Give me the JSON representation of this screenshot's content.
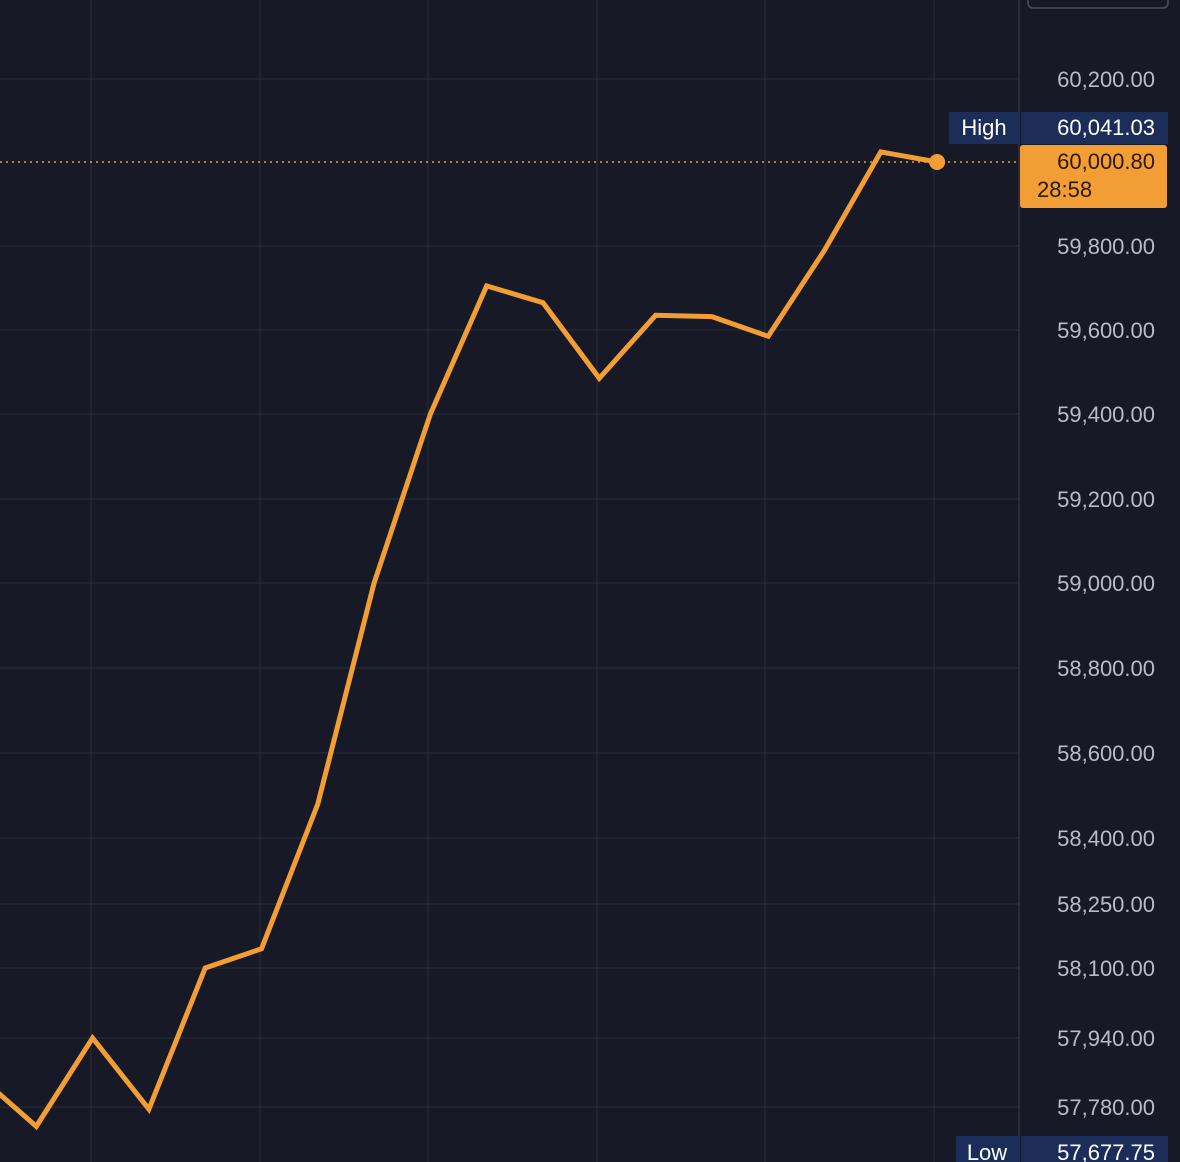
{
  "colors": {
    "background": "#171a26",
    "grid": "#2a2e3b",
    "axis_divider": "#3a3f4d",
    "line": "#f39e35",
    "tick_text": "#b9bcc6",
    "badge_navy": "#1c2d5a",
    "badge_text": "#ffffff",
    "current_badge_text": "#2a1a00"
  },
  "chart_data": {
    "type": "line",
    "title": "",
    "xlabel": "",
    "ylabel": "",
    "y_ticks": [
      "60,200.00",
      "59,800.00",
      "59,600.00",
      "59,400.00",
      "59,200.00",
      "59,000.00",
      "58,800.00",
      "58,600.00",
      "58,400.00",
      "58,250.00",
      "58,100.00",
      "57,940.00",
      "57,780.00"
    ],
    "y_tick_values": [
      60200,
      59800,
      59600,
      59400,
      59200,
      59000,
      58800,
      58600,
      58400,
      58250,
      58100,
      57940,
      57780
    ],
    "y_scale": "nonlinear",
    "grid": true,
    "series": [
      {
        "values": [
          57850,
          57735,
          57940,
          57775,
          58100,
          58145,
          58480,
          59000,
          59400,
          59705,
          59665,
          59485,
          59635,
          59632,
          59585,
          59790,
          60025,
          60000.8
        ]
      }
    ],
    "high": {
      "label": "High",
      "value": "60,041.03"
    },
    "low": {
      "label": "Low",
      "value": "57,677.75"
    },
    "current": {
      "value": "60,000.80",
      "countdown": "28:58",
      "raw": 60000.8
    }
  }
}
